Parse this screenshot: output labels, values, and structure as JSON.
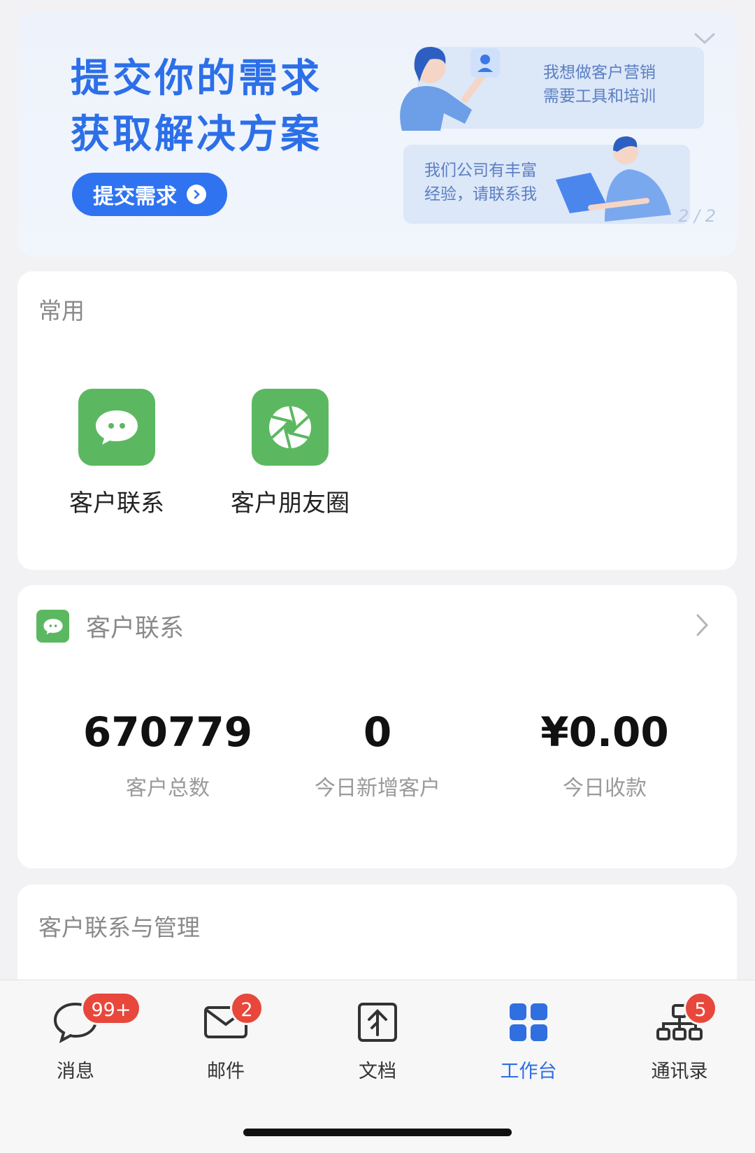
{
  "banner": {
    "title_line1": "提交你的需求",
    "title_line2": "获取解决方案",
    "button_label": "提交需求",
    "bubble1_line1": "我想做客户营销",
    "bubble1_line2": "需要工具和培训",
    "bubble2_line1": "我们公司有丰富",
    "bubble2_line2": "经验，请联系我",
    "pager": "2 / 2"
  },
  "common": {
    "title": "常用",
    "apps": [
      {
        "label": "客户联系",
        "icon": "chat-bubble-icon"
      },
      {
        "label": "客户朋友圈",
        "icon": "aperture-icon"
      }
    ]
  },
  "customer_stats": {
    "title": "客户联系",
    "stats": [
      {
        "value": "670779",
        "label": "客户总数"
      },
      {
        "value": "0",
        "label": "今日新增客户"
      },
      {
        "value": "¥0.00",
        "label": "今日收款"
      }
    ]
  },
  "manage": {
    "title": "客户联系与管理"
  },
  "tabbar": {
    "tabs": [
      {
        "label": "消息",
        "icon": "message-icon",
        "badge": "99+"
      },
      {
        "label": "邮件",
        "icon": "mail-icon",
        "badge": "2"
      },
      {
        "label": "文档",
        "icon": "document-icon",
        "badge": ""
      },
      {
        "label": "工作台",
        "icon": "workbench-grid-icon",
        "badge": "",
        "active": true
      },
      {
        "label": "通讯录",
        "icon": "contacts-org-icon",
        "badge": "5"
      }
    ]
  },
  "colors": {
    "accent": "#2f73f0",
    "app_green": "#5cb860",
    "badge_red": "#e8473b"
  }
}
